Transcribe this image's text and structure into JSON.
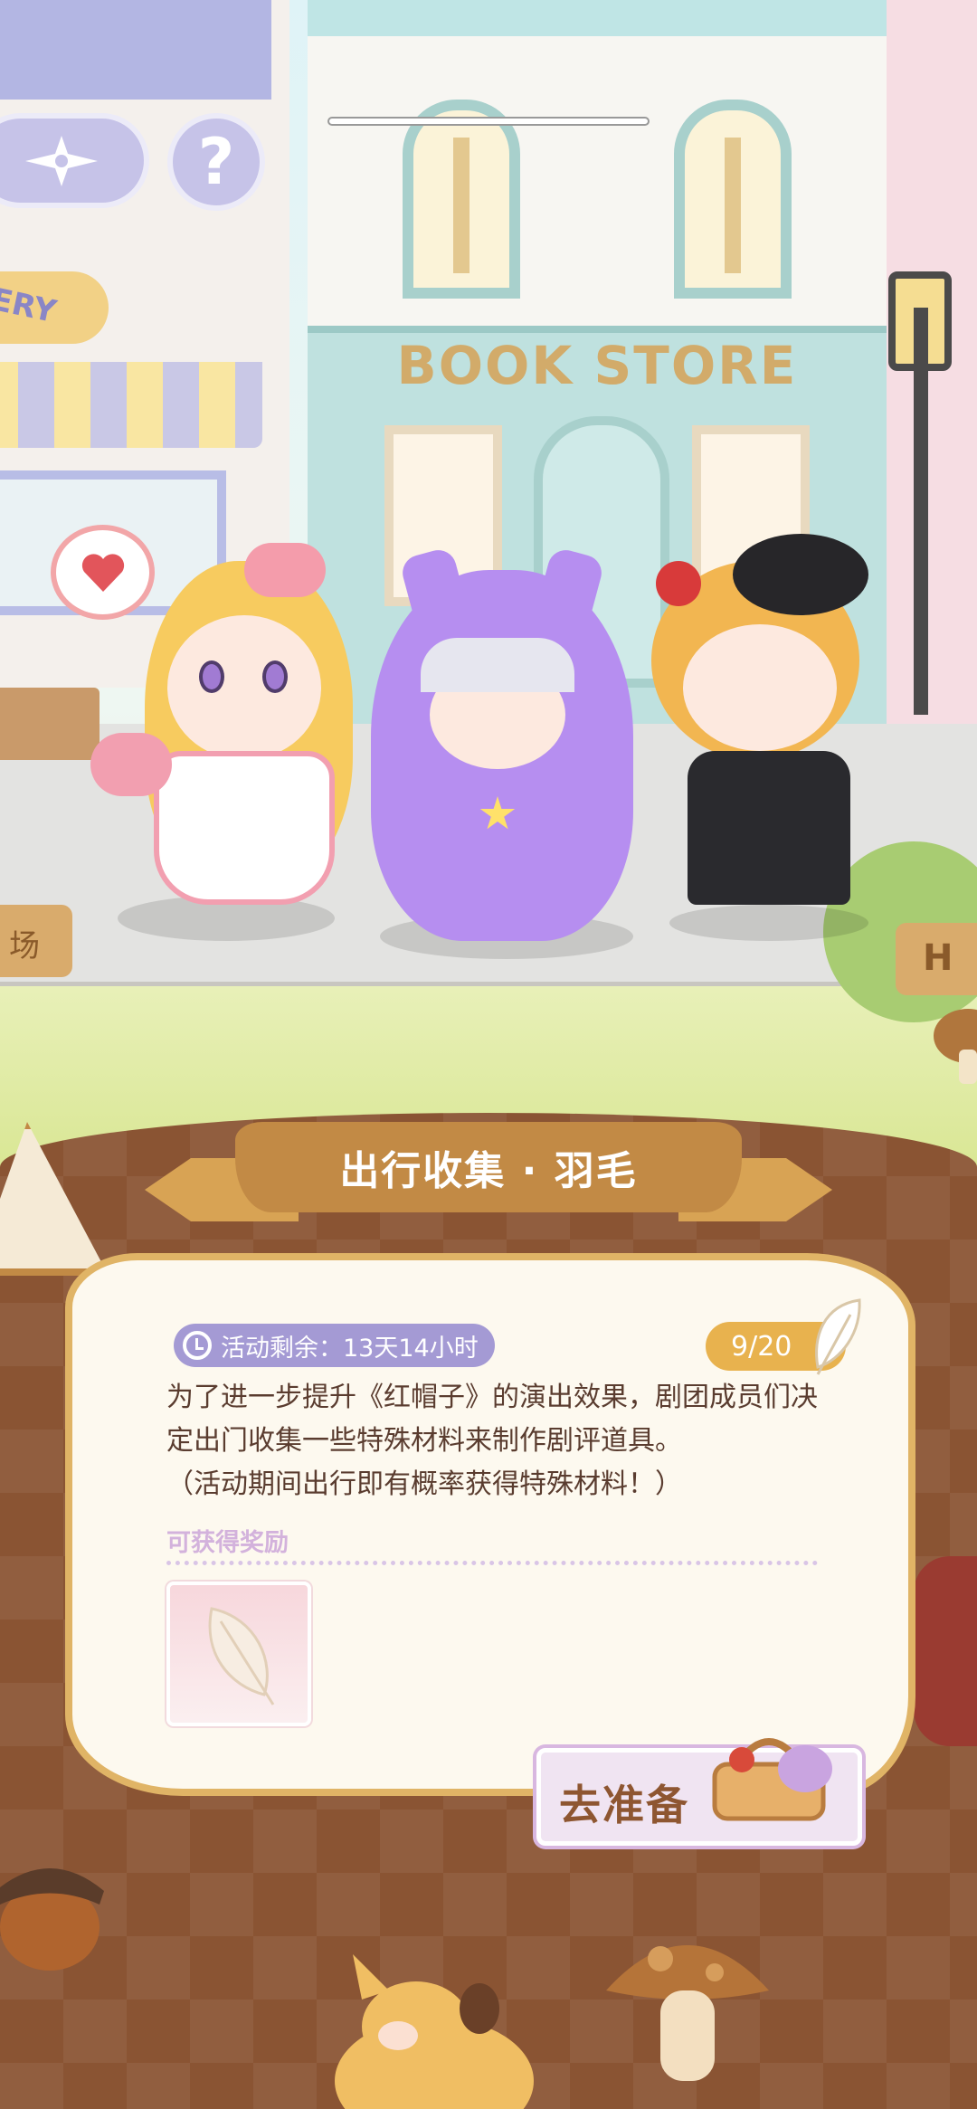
{
  "scene": {
    "store_sign": "BOOK STORE",
    "bakery_sign": "ERY",
    "left_sign": "场",
    "right_sign": "H"
  },
  "top_buttons": {
    "compass_icon": "compass-icon",
    "help_label": "?"
  },
  "event": {
    "title": "出行收集 · 羽毛",
    "timer_label": "活动剩余：13天14小时",
    "progress_label": "9/20",
    "progress_fraction": 0.45,
    "description_lines": [
      "为了进一步提升《红帽子》的演出效果，剧团成员们决",
      "定出门收集一些特殊材料来制作剧评道具。",
      "（活动期间出行即有概率获得特殊材料！）"
    ],
    "reward_label": "可获得奖励",
    "reward_item_icon": "feather-icon",
    "action_label": "去准备"
  },
  "colors": {
    "ribbon": "#c28a45",
    "card_border": "#e0b466",
    "timer_pill": "#a49ad4",
    "progress_pill": "#e8b24e",
    "text": "#5a3c2f",
    "button_text": "#8e5631"
  }
}
